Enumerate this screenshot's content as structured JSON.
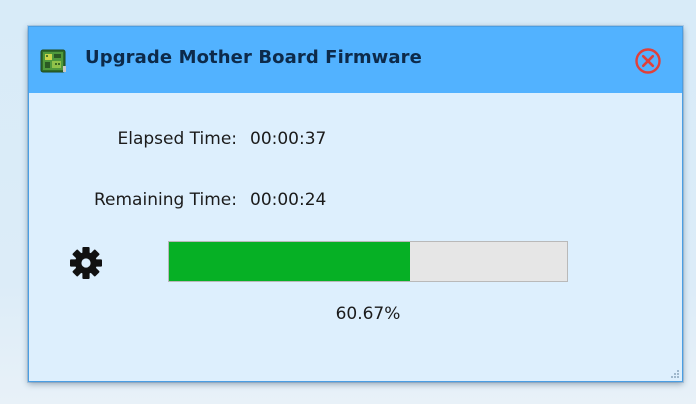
{
  "window": {
    "title": "Upgrade Mother Board Firmware",
    "app_icon": "circuit-board-icon",
    "close_icon": "close-circle-icon"
  },
  "timing": {
    "elapsed_label": "Elapsed Time:",
    "elapsed_value": "00:00:37",
    "remaining_label": "Remaining Time:",
    "remaining_value": "00:00:24"
  },
  "progress": {
    "status_icon": "gear-icon",
    "fraction": 0.6067,
    "percent_text": "60.67%"
  },
  "colors": {
    "titlebar": "#52b2ff",
    "body": "#ddeffd",
    "progress_fill": "#06b025",
    "progress_track": "#e6e6e6",
    "close_icon": "#e0403a"
  }
}
